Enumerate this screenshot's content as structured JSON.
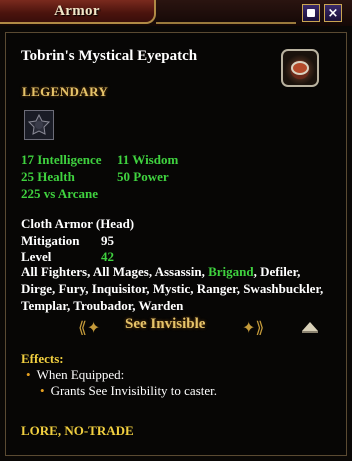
{
  "window": {
    "title": "Armor"
  },
  "item": {
    "name": "Tobrin's Mystical Eyepatch",
    "tier": "LEGENDARY",
    "stats": [
      {
        "label": "17 Intelligence"
      },
      {
        "label": "11 Wisdom"
      },
      {
        "label": "25 Health"
      },
      {
        "label": "50 Power"
      },
      {
        "label": "225 vs Arcane"
      }
    ],
    "type": "Cloth Armor (Head)",
    "mitigation_label": "Mitigation",
    "mitigation_value": "95",
    "level_label": "Level",
    "level_value": "42",
    "classes_before": "All Fighters, All Mages, Assassin, ",
    "classes_highlight": "Brigand",
    "classes_after": ", Defiler, Dirge, Fury, Inquisitor, Mystic, Ranger, Swashbuckler, Templar, Troubador, Warden",
    "set_effect": "See Invisible",
    "effects_label": "Effects:",
    "effect_trigger": "When Equipped:",
    "effect_detail": "Grants See Invisibility to caster.",
    "flags": "LORE, NO-TRADE"
  },
  "colors": {
    "stat_green": "#3fd23f",
    "legendary_gold": "#e6c46a",
    "title_red": "#7a2a1e"
  },
  "icons": {
    "pin": "pin-icon",
    "close": "close-icon",
    "item": "eyepatch-icon",
    "adornment": "adornment-slot-icon",
    "scroll_up": "scroll-up-arrow-icon"
  }
}
